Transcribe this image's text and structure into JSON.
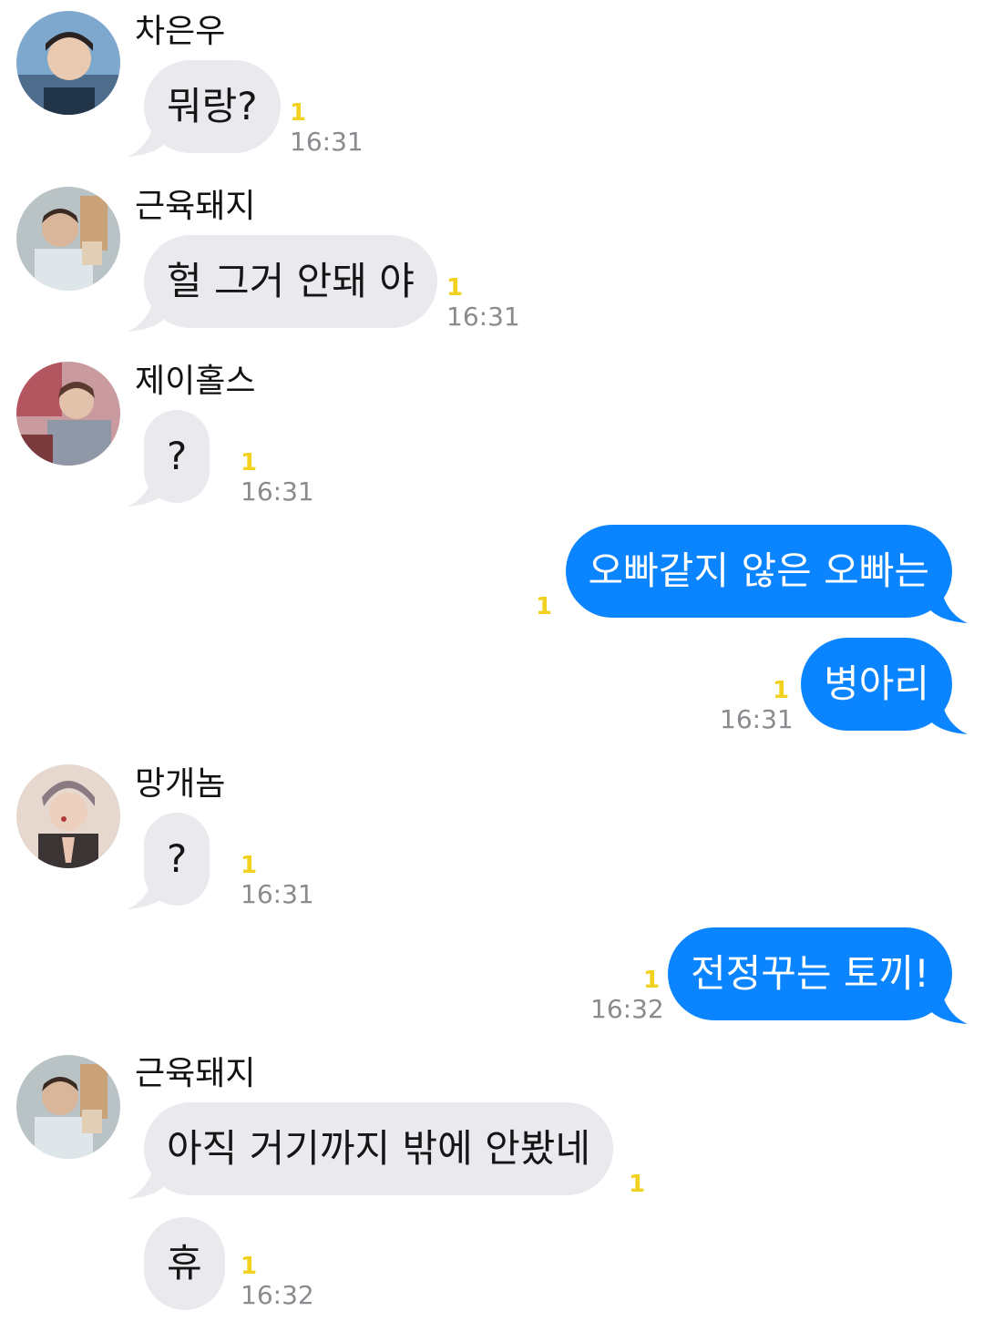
{
  "colors": {
    "incoming_bubble": "#e9e9ee",
    "outgoing_bubble": "#0a84ff",
    "unread_badge": "#f2d21f",
    "timestamp": "#8a8a8f"
  },
  "messages": [
    {
      "sender": "차은우",
      "text": "뭐랑?",
      "unread": "1",
      "time": "16:31"
    },
    {
      "sender": "근육돼지",
      "text": "헐 그거 안돼 야",
      "unread": "1",
      "time": "16:31"
    },
    {
      "sender": "제이홀스",
      "text": "?",
      "unread": "1",
      "time": "16:31"
    },
    {
      "sender": "me",
      "text": "오빠같지 않은 오빠는",
      "unread": "1",
      "time": ""
    },
    {
      "sender": "me",
      "text": "병아리",
      "unread": "1",
      "time": "16:31"
    },
    {
      "sender": "망개놈",
      "text": "?",
      "unread": "1",
      "time": "16:31"
    },
    {
      "sender": "me",
      "text": "전정꾸는 토끼!",
      "unread": "1",
      "time": "16:32"
    },
    {
      "sender": "근육돼지",
      "text": "아직 거기까지 밖에 안봤네",
      "unread": "1",
      "time": ""
    },
    {
      "sender": "근육돼지",
      "text": "휴",
      "unread": "1",
      "time": "16:32"
    }
  ]
}
